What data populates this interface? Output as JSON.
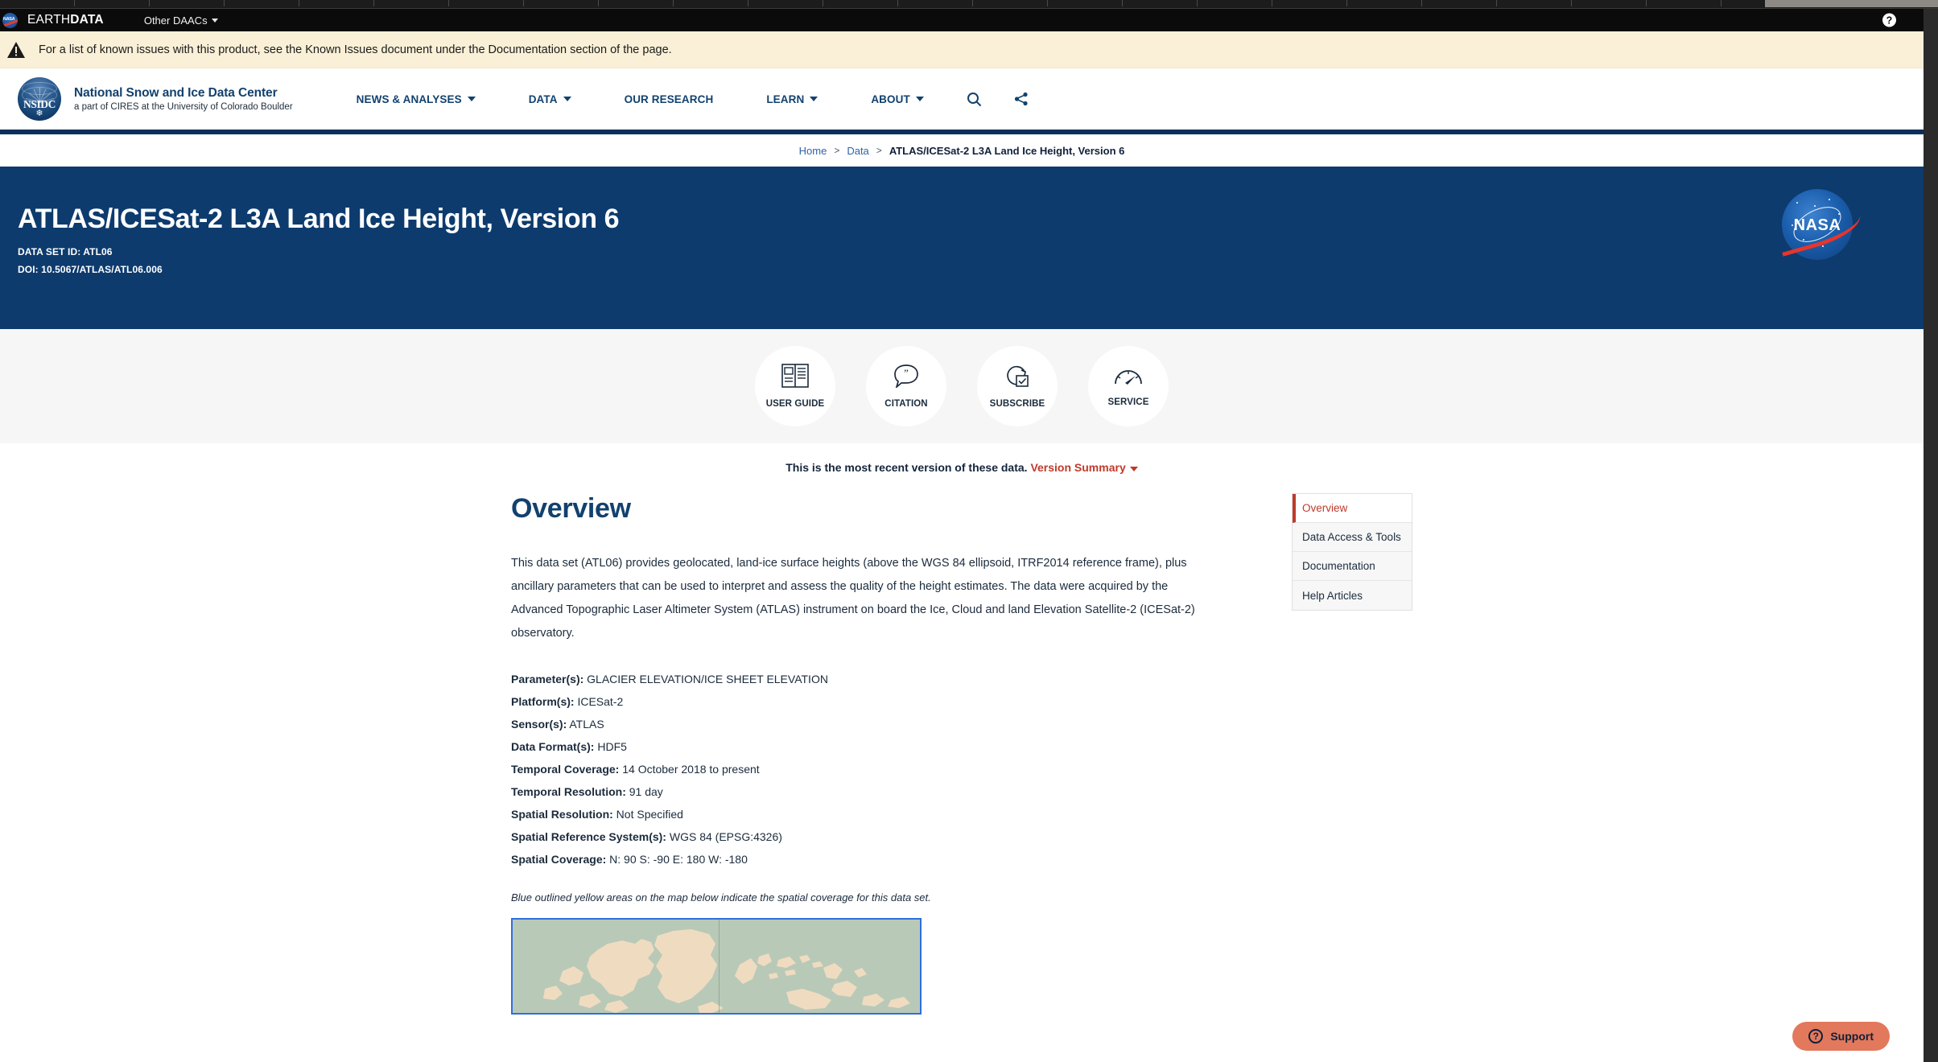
{
  "earthdata_bar": {
    "wordmark_light": "EARTH",
    "wordmark_bold": "DATA",
    "other_daacs": "Other DAACs",
    "help_glyph": "?",
    "nasa_text": "NASA"
  },
  "alert": {
    "icon": "warning-triangle-icon",
    "message": "For a list of known issues with this product, see the Known Issues document under the Documentation section of the page."
  },
  "site_header": {
    "logo_text": "NSIDC",
    "org_name": "National Snow and Ice Data Center",
    "org_tagline": "a part of CIRES at the University of Colorado Boulder",
    "nav": [
      {
        "label": "NEWS & ANALYSES",
        "has_caret": true
      },
      {
        "label": "DATA",
        "has_caret": true
      },
      {
        "label": "OUR RESEARCH",
        "has_caret": false
      },
      {
        "label": "LEARN",
        "has_caret": true
      },
      {
        "label": "ABOUT",
        "has_caret": true
      }
    ],
    "search_icon": "search-icon",
    "share_icon": "share-icon"
  },
  "breadcrumb": {
    "items": [
      "Home",
      "Data"
    ],
    "separator": ">",
    "current": "ATLAS/ICESat-2 L3A Land Ice Height, Version 6"
  },
  "hero": {
    "title": "ATLAS/ICESat-2 L3A Land Ice Height, Version 6",
    "data_set_id": "DATA SET ID: ATL06",
    "doi": "DOI: 10.5067/ATLAS/ATL06.006",
    "nasa_word": "NASA",
    "background_color": "#0d3b6e"
  },
  "quick_actions": [
    {
      "label": "USER GUIDE",
      "icon": "book-pages-icon"
    },
    {
      "label": "CITATION",
      "icon": "quote-bubble-icon"
    },
    {
      "label": "SUBSCRIBE",
      "icon": "refresh-checkbox-icon"
    },
    {
      "label": "SERVICE",
      "icon": "gauge-icon"
    }
  ],
  "version_notice": {
    "text": "This is the most recent version of these data.",
    "link_label": "Version Summary",
    "link_color": "#c0392b"
  },
  "overview": {
    "heading": "Overview",
    "lead": "This data set (ATL06) provides geolocated, land-ice surface heights (above the WGS 84 ellipsoid, ITRF2014 reference frame), plus ancillary parameters that can be used to interpret and assess the quality of the height estimates. The data were acquired by the Advanced Topographic Laser Altimeter System (ATLAS) instrument on board the Ice, Cloud and land Elevation Satellite-2 (ICESat-2) observatory.",
    "metadata": [
      {
        "key": "Parameter(s):",
        "value": " GLACIER ELEVATION/ICE SHEET ELEVATION"
      },
      {
        "key": "Platform(s):",
        "value": " ICESat-2"
      },
      {
        "key": "Sensor(s):",
        "value": " ATLAS"
      },
      {
        "key": "Data Format(s):",
        "value": " HDF5"
      },
      {
        "key": "Temporal Coverage:",
        "value": " 14 October 2018 to present"
      },
      {
        "key": "Temporal Resolution:",
        "value": " 91 day"
      },
      {
        "key": "Spatial Resolution:",
        "value": " Not Specified"
      },
      {
        "key": "Spatial Reference System(s):",
        "value": " WGS 84 (EPSG:4326)"
      },
      {
        "key": "Spatial Coverage:",
        "value": " N: 90  S: -90  E: 180  W: -180"
      }
    ],
    "map_note": "Blue outlined yellow areas on the map below indicate the spatial coverage for this data set.",
    "map_outline_color": "#2f6ee0",
    "map_ocean_color": "#b9c9b8",
    "map_land_color": "#efdcc0"
  },
  "side_nav": {
    "items": [
      {
        "label": "Overview",
        "active": true
      },
      {
        "label": "Data Access & Tools",
        "active": false
      },
      {
        "label": "Documentation",
        "active": false
      },
      {
        "label": "Help Articles",
        "active": false
      }
    ]
  },
  "support_widget": {
    "label": "Support",
    "icon_glyph": "?",
    "background_color": "#e2785c"
  }
}
